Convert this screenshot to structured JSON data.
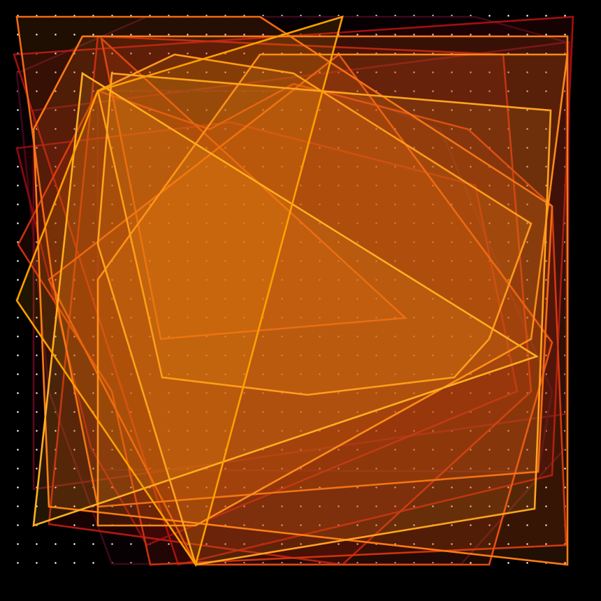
{
  "artwork": {
    "background": "#000000",
    "dot_color": "#ffffff",
    "palette": [
      "#ffb020",
      "#ff9a1a",
      "#ff7a14",
      "#f05a10",
      "#d03a10",
      "#b01a10",
      "#8a0a10",
      "#5a0a1a",
      "#3a0a1a"
    ]
  }
}
